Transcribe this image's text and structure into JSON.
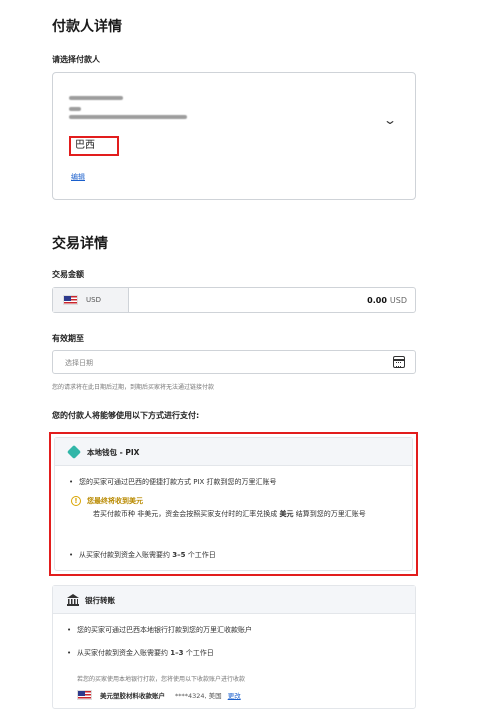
{
  "payer_section": {
    "title": "付款人详情",
    "select_label": "请选择付款人",
    "country": "巴西",
    "edit_link": "编辑",
    "expand_icon": "chevron-down-icon"
  },
  "transaction_section": {
    "title": "交易详情",
    "amount_label": "交易金额",
    "currency_selected": "USD",
    "amount_value": "0.00",
    "amount_currency_suffix": "USD",
    "expiry_label": "有效期至",
    "date_placeholder": "选择日期",
    "expiry_helper": "您的请求将在此日期后过期，到期后买家将无法通过链接付款"
  },
  "methods_title": "您的付款人将能够使用以下方式进行支付:",
  "pix_card": {
    "title": "本地钱包 - PIX",
    "bullet1": "您的买家可通过巴西的便捷打款方式 PIX 打款到您的万里汇账号",
    "warning_title": "您最终将收到美元",
    "warning_text_a": "若买付款币种 非美元，资金会按照买家支付时的汇率兑换成",
    "warning_text_bold": "美元",
    "warning_text_b": "结算到您的万里汇账号",
    "bullet2_a": "从买家付款到资金入账需要约",
    "bullet2_bold": "3–5",
    "bullet2_b": "个工作日"
  },
  "bank_card": {
    "title": "银行转账",
    "bullet1": "您的买家可通过巴西本地银行打款到您的万里汇收款账户",
    "bullet2_a": "从买家付款到资金入账需要约",
    "bullet2_bold": "1–3",
    "bullet2_b": "个工作日",
    "note": "若您的买家使用本地银行打款，您将使用以下收款账户进行收款",
    "account_name": "美元塑胶材料收款账户",
    "account_number": "****4324, 美国",
    "change_link": "更改"
  },
  "colors": {
    "highlight_red": "#e21d1d",
    "link_blue": "#1a5fcc",
    "pix_teal": "#31b6a8",
    "warning_amber": "#b98a00"
  }
}
